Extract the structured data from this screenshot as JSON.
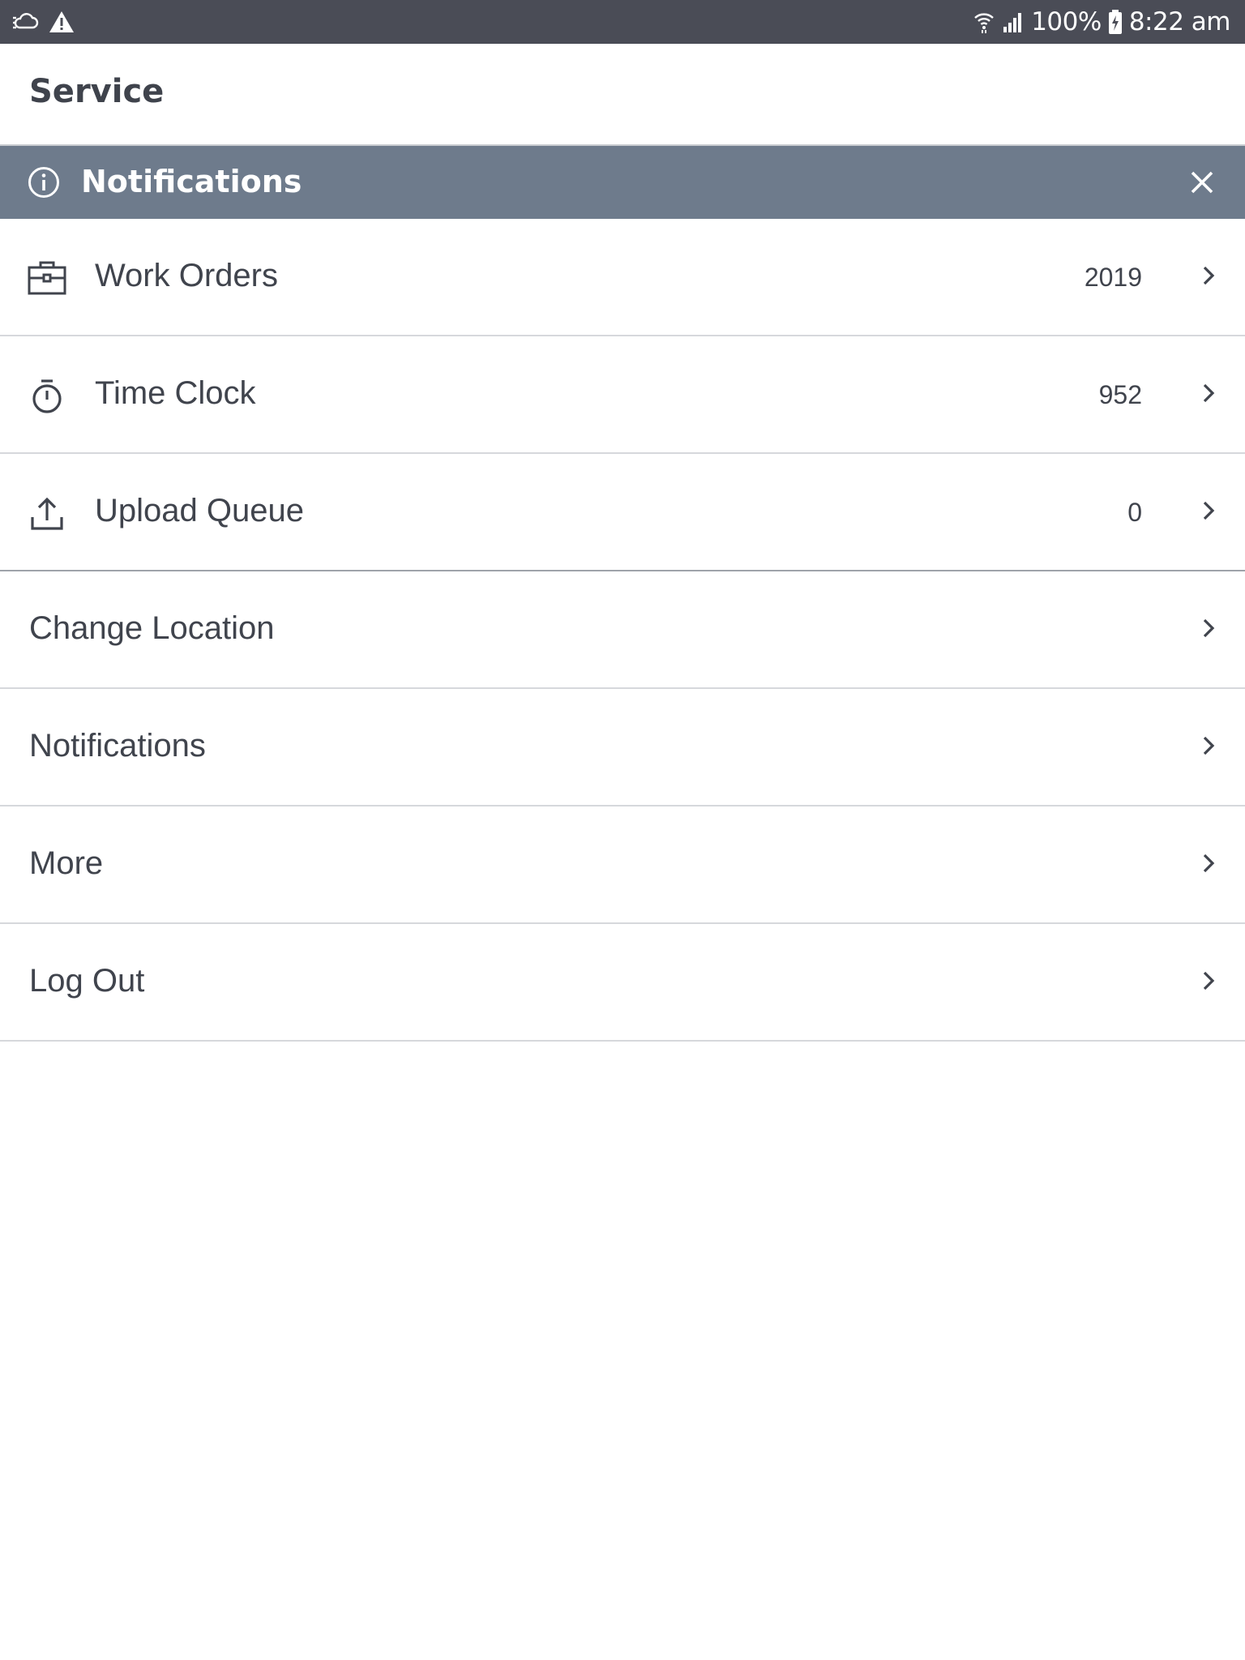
{
  "status_bar": {
    "battery": "100%",
    "time": "8:22 am",
    "left_icons": [
      "sync-cloud-icon",
      "warning-icon"
    ],
    "right_icons": [
      "wifi-icon",
      "signal-icon",
      "battery-charging-icon"
    ]
  },
  "header": {
    "title": "Service"
  },
  "banner": {
    "title": "Notifications",
    "icon": "info-icon",
    "close_icon": "close-icon",
    "background": "#6e7b8c"
  },
  "menu": {
    "items": [
      {
        "label": "Work Orders",
        "count": "2019",
        "icon": "briefcase-icon"
      },
      {
        "label": "Time Clock",
        "count": "952",
        "icon": "stopwatch-icon"
      },
      {
        "label": "Upload Queue",
        "count": "0",
        "icon": "upload-icon"
      },
      {
        "label": "Change Location"
      },
      {
        "label": "Notifications"
      },
      {
        "label": "More"
      },
      {
        "label": "Log Out"
      }
    ]
  },
  "colors": {
    "status_bar": "#4a4c56",
    "text": "#40444d",
    "divider": "#d6d8dc"
  }
}
